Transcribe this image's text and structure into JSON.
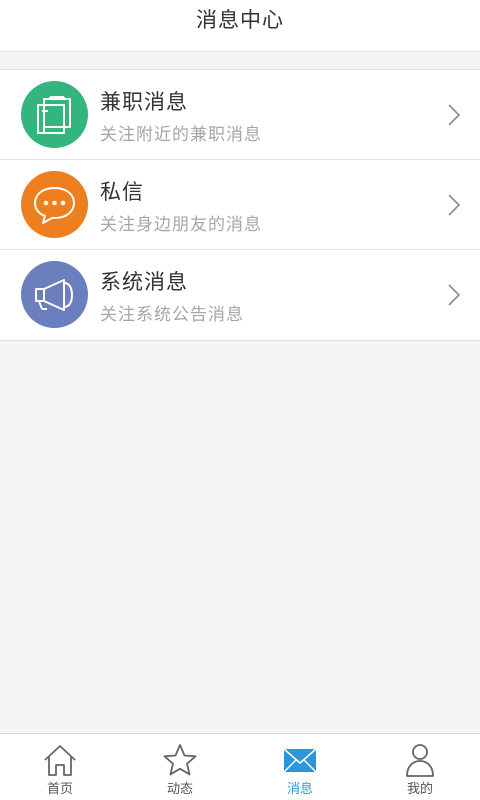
{
  "header": {
    "title": "消息中心"
  },
  "messages": [
    {
      "title": "兼职消息",
      "subtitle": "关注附近的兼职消息",
      "icon": "suitcase-icon",
      "color": "#35b57e"
    },
    {
      "title": "私信",
      "subtitle": "关注身边朋友的消息",
      "icon": "chat-bubble-icon",
      "color": "#ee7f1e"
    },
    {
      "title": "系统消息",
      "subtitle": "关注系统公告消息",
      "icon": "megaphone-icon",
      "color": "#6b7fbf"
    }
  ],
  "tabs": [
    {
      "label": "首页",
      "icon": "home-icon",
      "active": false
    },
    {
      "label": "动态",
      "icon": "star-icon",
      "active": false
    },
    {
      "label": "消息",
      "icon": "mail-icon",
      "active": true
    },
    {
      "label": "我的",
      "icon": "user-icon",
      "active": false
    }
  ],
  "colors": {
    "tab_active": "#2b97d9",
    "tab_inactive": "#555555"
  }
}
